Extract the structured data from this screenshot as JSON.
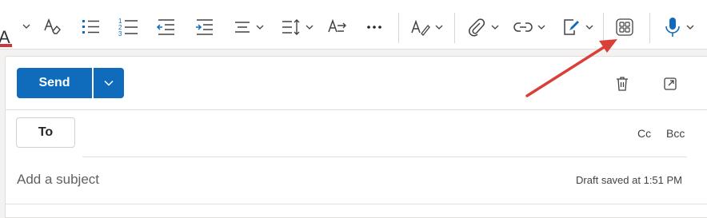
{
  "toolbar": {
    "font_color_letter": "A",
    "font_color_accent": "#d13438",
    "icons": [
      "font-color-icon",
      "clear-formatting-icon",
      "bullets-icon",
      "numbering-icon",
      "decrease-indent-icon",
      "increase-indent-icon",
      "align-icon",
      "line-spacing-icon",
      "text-direction-icon",
      "more-icon",
      "styles-icon",
      "attach-icon",
      "link-icon",
      "signature-icon",
      "apps-icon",
      "dictate-icon"
    ]
  },
  "compose": {
    "send_label": "Send",
    "to_label": "To",
    "cc_label": "Cc",
    "bcc_label": "Bcc",
    "subject_placeholder": "Add a subject",
    "draft_status": "Draft saved at 1:51 PM"
  },
  "colors": {
    "accent": "#0f6cbd",
    "annotation_arrow": "#d9403a"
  }
}
